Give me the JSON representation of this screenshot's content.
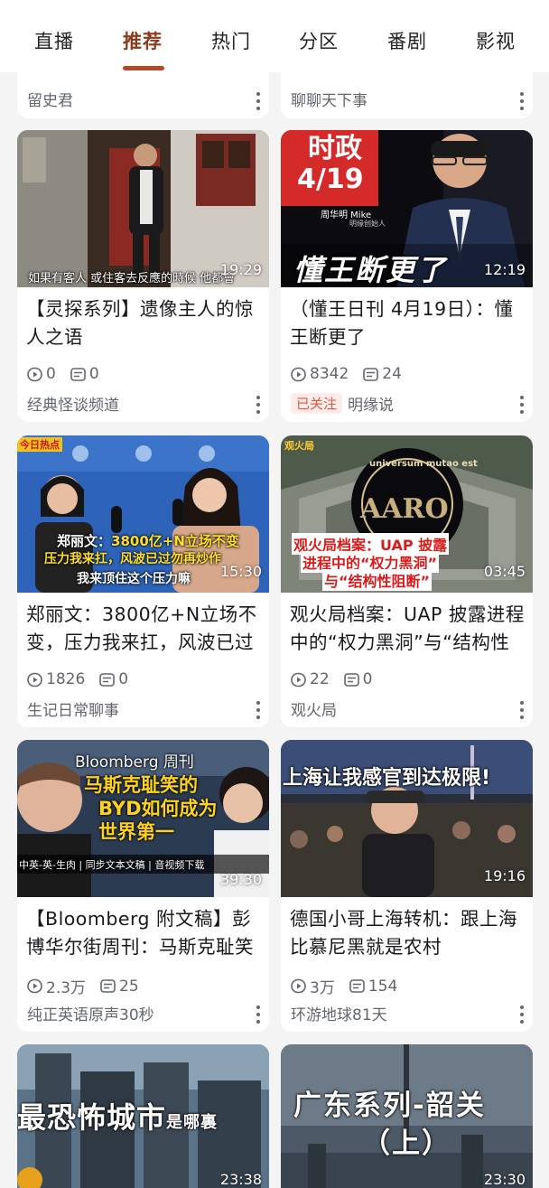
{
  "tabs": [
    "直播",
    "推荐",
    "热门",
    "分区",
    "番剧",
    "影视"
  ],
  "active_tab": "推荐",
  "top_stubs": [
    {
      "author": "留史君"
    },
    {
      "author": "聊聊天下事"
    }
  ],
  "videos": [
    {
      "title": "【灵探系列】遗像主人的惊人之语",
      "views": "0",
      "danmaku": "0",
      "author": "经典怪谈频道",
      "duration": "19:29",
      "followed": false,
      "overlay": "如果有客人  或住客去反應的時候  他都會"
    },
    {
      "title": "（懂王日刊 4月19日）：懂王断更了",
      "views": "8342",
      "danmaku": "24",
      "author": "明缘说",
      "duration": "12:19",
      "followed": true,
      "follow_label": "已关注",
      "overlay_badge_line1": "时政",
      "overlay_badge_line2": "4/19",
      "overlay_name": "周华明 Mike",
      "overlay_sub": "明缘创始人",
      "overlay": "懂王断更了"
    },
    {
      "title": "郑丽文：3800亿+N立场不变，压力我来扛，风波已过勿再炒作",
      "views": "1826",
      "danmaku": "0",
      "author": "生记日常聊事",
      "duration": "15:30",
      "followed": false,
      "overlay_tag": "今日热点",
      "overlay_line1_a": "郑丽文：",
      "overlay_line1_b": "3800亿+N立场不变",
      "overlay_line2": "压力我来扛，风波已过勿再炒作",
      "overlay_line3": "我来顶住这个压力嘛"
    },
    {
      "title": "观火局档案：UAP 披露进程中的“权力黑洞”与“结构性阻断”",
      "views": "22",
      "danmaku": "0",
      "author": "观火局",
      "duration": "03:45",
      "followed": false,
      "overlay_tag": "观火局",
      "overlay_arc": "universum mutao est",
      "overlay_logo": "AARO",
      "overlay_line1": "观火局档案：UAP 披露",
      "overlay_line2": "进程中的“权力黑洞”",
      "overlay_line3": "与“结构性阻断”"
    },
    {
      "title": "【Bloomberg 附文稿】彭博华尔街周刊：马斯克耻笑的BYD如何成为世界第一",
      "views": "2.3万",
      "danmaku": "25",
      "author": "纯正英语原声30秒",
      "duration": "39:30",
      "followed": false,
      "overlay_line1": "Bloomberg 周刊",
      "overlay_line2": "马斯克耻笑的",
      "overlay_line3": "BYD如何成为",
      "overlay_line4": "世界第一",
      "overlay_bar": "中英-英-生肉 | 同步文本文稿 | 音视频下载"
    },
    {
      "title": "德国小哥上海转机：跟上海比慕尼黑就是农村",
      "views": "3万",
      "danmaku": "154",
      "author": "环游地球81天",
      "duration": "19:16",
      "followed": false,
      "overlay": "上海让我感官到达极限!"
    },
    {
      "title": "",
      "views": "",
      "danmaku": "",
      "author": "",
      "duration": "23:38",
      "followed": false,
      "overlay_main": "最恐怖城市",
      "overlay_small": "是哪裏"
    },
    {
      "title": "",
      "views": "",
      "danmaku": "",
      "author": "",
      "duration": "23:30",
      "followed": false,
      "overlay_line1": "广东系列-韶关",
      "overlay_line2": "（上）"
    }
  ],
  "colors": {
    "accent": "#b24a2a",
    "active_tab_text": "#8b3a1e",
    "follow_bg": "#fdecea",
    "follow_text": "#e0553f"
  },
  "icons": {
    "views": "play-circle-icon",
    "danmaku": "danmaku-icon",
    "more": "more-vertical-icon"
  }
}
